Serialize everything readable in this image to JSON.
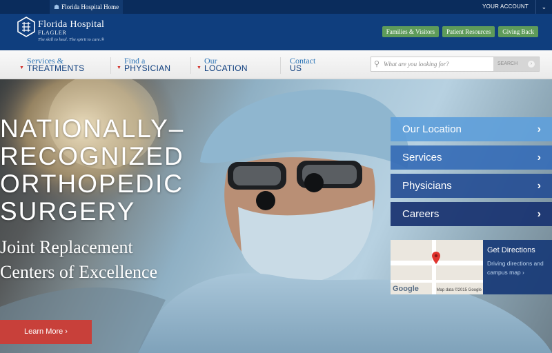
{
  "topbar": {
    "home_link": "Florida Hospital Home",
    "home_icon": "house-icon",
    "account_label": "YOUR ACCOUNT",
    "account_icon": "chevron-down-icon"
  },
  "header": {
    "logo_name": "Florida Hospital",
    "logo_sub": "FLAGLER",
    "logo_tagline": "The skill to heal. The spirit to care.®",
    "buttons": [
      "Families & Visitors",
      "Patient Resources",
      "Giving Back"
    ],
    "background_color": "#0f3e7e",
    "button_color": "#5e9b5a"
  },
  "nav": {
    "items": [
      {
        "line1": "Services &",
        "line2": "TREATMENTS"
      },
      {
        "line1": "Find a",
        "line2": "PHYSICIAN"
      },
      {
        "line1": "Our",
        "line2": "LOCATION"
      },
      {
        "line1": "Contact",
        "line2": "US"
      }
    ],
    "search_placeholder": "What are you looking for?",
    "search_button": "SEARCH"
  },
  "hero": {
    "title": "NATIONALLY–RECOGNIZED ORTHOPEDIC SURGERY",
    "subtitle": "Joint Replacement Centers of Excellence",
    "cta": "Learn More ›",
    "cta_color": "#c8403a"
  },
  "quick_links": [
    "Our Location",
    "Services",
    "Physicians",
    "Careers"
  ],
  "directions": {
    "title": "Get Directions",
    "description": "Driving directions and campus map ›",
    "map_logo": "Google",
    "map_credit": "Map data ©2015 Google"
  }
}
